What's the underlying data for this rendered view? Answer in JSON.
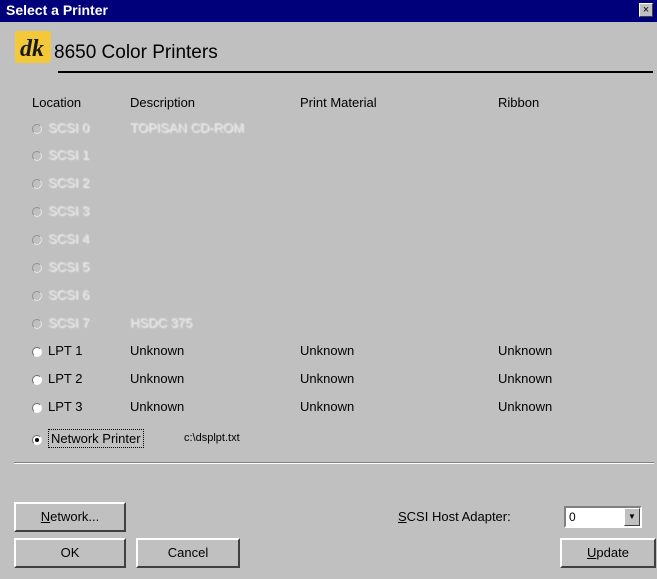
{
  "window": {
    "title": "Select a Printer",
    "close_symbol": "×"
  },
  "header": {
    "logo_text": "dk",
    "heading": "8650 Color Printers"
  },
  "columns": {
    "location": "Location",
    "description": "Description",
    "print_material": "Print Material",
    "ribbon": "Ribbon"
  },
  "rows": [
    {
      "location": "SCSI 0",
      "description": "TOPISAN CD-ROM",
      "material": "",
      "ribbon": ""
    },
    {
      "location": "SCSI 1",
      "description": "",
      "material": "",
      "ribbon": ""
    },
    {
      "location": "SCSI 2",
      "description": "",
      "material": "",
      "ribbon": ""
    },
    {
      "location": "SCSI 3",
      "description": "",
      "material": "",
      "ribbon": ""
    },
    {
      "location": "SCSI 4",
      "description": "",
      "material": "",
      "ribbon": ""
    },
    {
      "location": "SCSI 5",
      "description": "",
      "material": "",
      "ribbon": ""
    },
    {
      "location": "SCSI 6",
      "description": "",
      "material": "",
      "ribbon": ""
    },
    {
      "location": "SCSI 7",
      "description": "HSDC 375",
      "material": "",
      "ribbon": ""
    },
    {
      "location": "LPT 1",
      "description": "Unknown",
      "material": "Unknown",
      "ribbon": "Unknown"
    },
    {
      "location": "LPT 2",
      "description": "Unknown",
      "material": "Unknown",
      "ribbon": "Unknown"
    },
    {
      "location": "LPT 3",
      "description": "Unknown",
      "material": "Unknown",
      "ribbon": "Unknown"
    }
  ],
  "network": {
    "label": "Network Printer",
    "path": "c:\\dsplpt.txt"
  },
  "buttons": {
    "network": {
      "hotkey": "N",
      "rest": "etwork..."
    },
    "ok": "OK",
    "cancel": "Cancel",
    "update": {
      "hotkey": "U",
      "rest": "pdate"
    }
  },
  "scsi_host": {
    "hotkey": "S",
    "rest": "CSI Host Adapter:",
    "value": "0"
  },
  "colors": {
    "titlebar": "#00007b",
    "face": "#c0c0c0"
  }
}
